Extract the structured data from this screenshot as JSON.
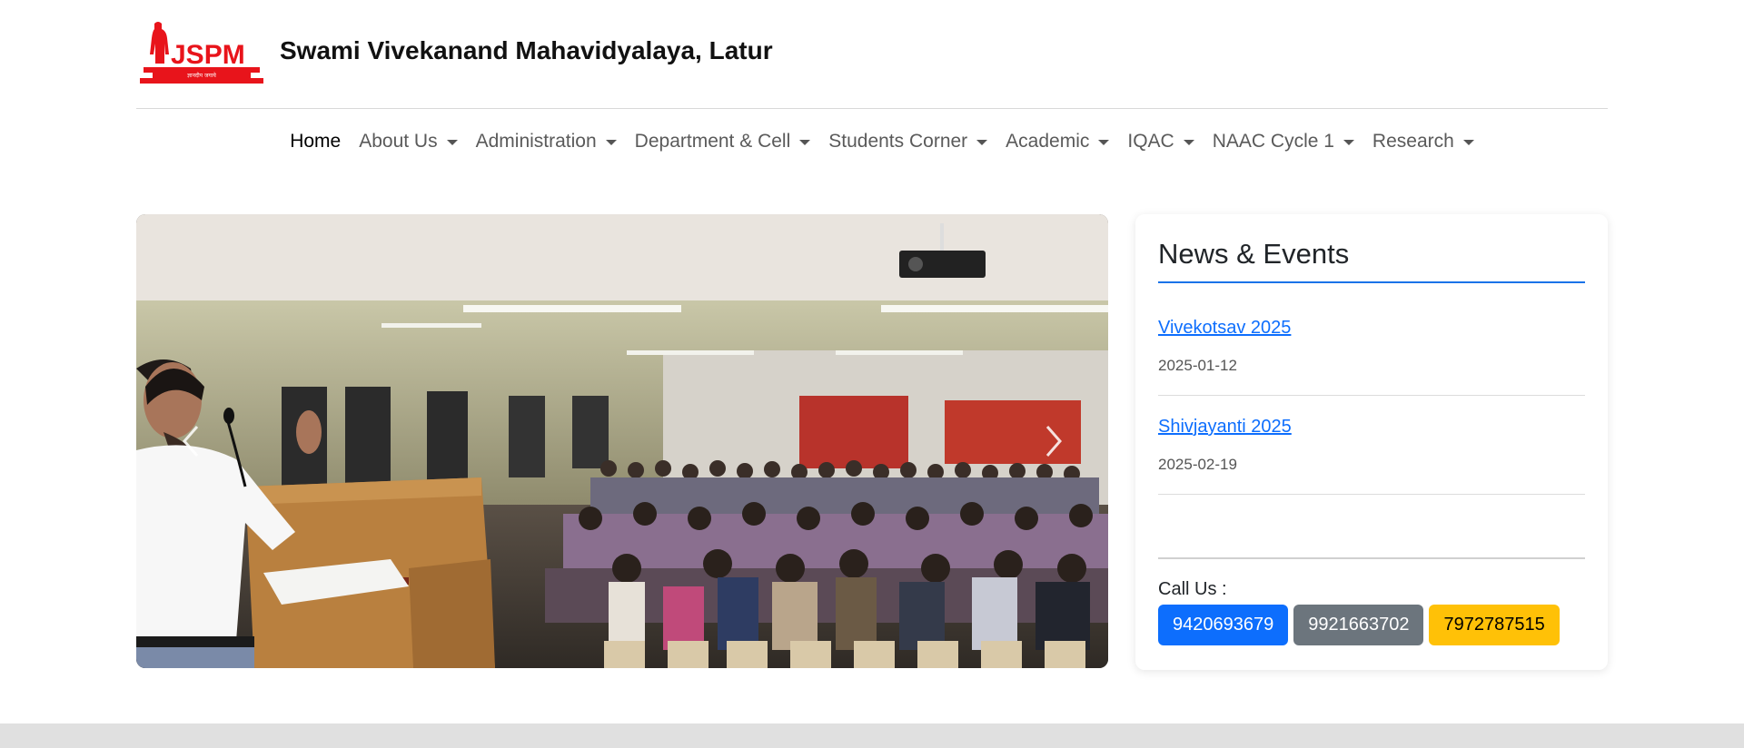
{
  "header": {
    "logo_text": "JSPM",
    "logo_subtext": "ज्ञानदीप जगाये",
    "title": "Swami Vivekanand Mahavidyalaya, Latur"
  },
  "nav": {
    "items": [
      {
        "label": "Home",
        "active": true,
        "dropdown": false
      },
      {
        "label": "About Us",
        "dropdown": true
      },
      {
        "label": "Administration",
        "dropdown": true
      },
      {
        "label": "Department & Cell",
        "dropdown": true
      },
      {
        "label": "Students Corner",
        "dropdown": true
      },
      {
        "label": "Academic",
        "dropdown": true
      },
      {
        "label": "IQAC",
        "dropdown": true
      },
      {
        "label": "NAAC Cycle 1",
        "dropdown": true
      },
      {
        "label": "Research",
        "dropdown": true
      }
    ]
  },
  "carousel": {
    "prev_icon": "chevron-left-icon",
    "next_icon": "chevron-right-icon"
  },
  "news": {
    "title": "News & Events",
    "items": [
      {
        "title": "Vivekotsav 2025",
        "date": "2025-01-12"
      },
      {
        "title": "Shivjayanti 2025",
        "date": "2025-02-19"
      }
    ],
    "call_label": "Call Us :",
    "phones": [
      "9420693679",
      "9921663702",
      "7972787515"
    ]
  },
  "colors": {
    "brand_red": "#e8141b",
    "link_blue": "#0d6efd",
    "secondary_gray": "#6c757d",
    "warning_yellow": "#ffc107"
  }
}
